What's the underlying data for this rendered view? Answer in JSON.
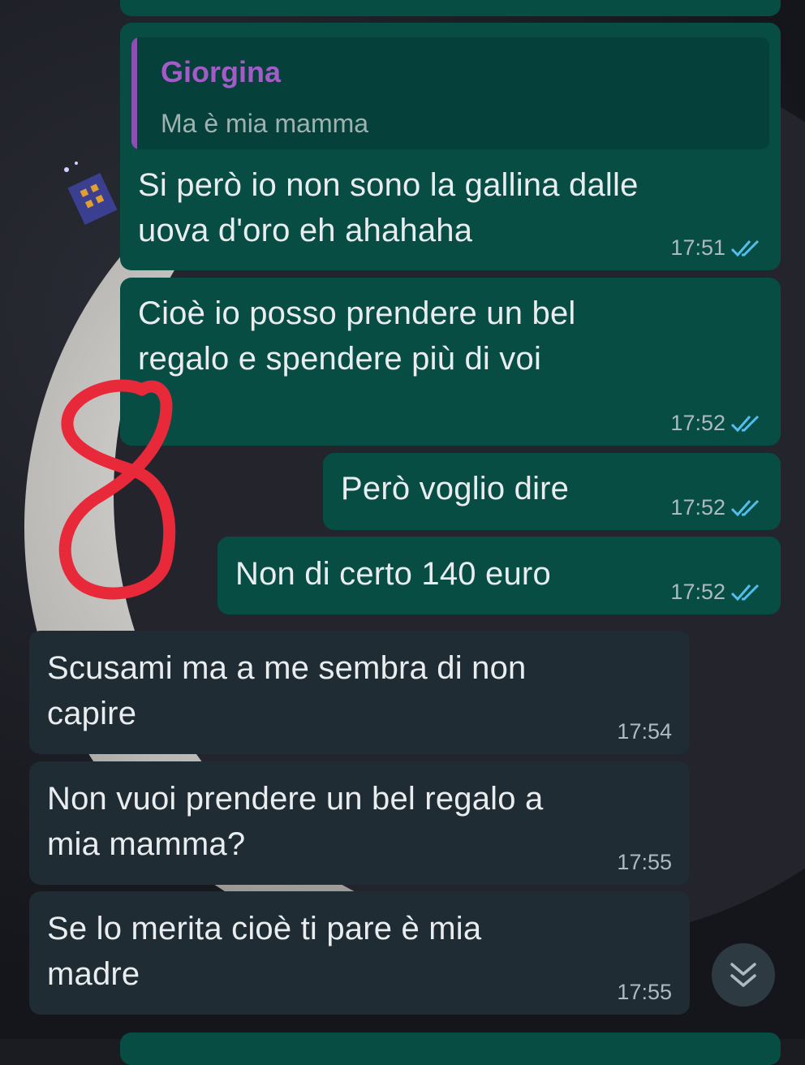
{
  "messages": [
    {
      "direction": "outgoing",
      "reply_to": {
        "author": "Giorgina",
        "text": "Ma è mia mamma"
      },
      "text_lines": [
        "Si però io non sono la gallina dalle",
        "uova d'oro eh ahahaha"
      ],
      "time": "17:51",
      "status": "read"
    },
    {
      "direction": "outgoing",
      "text_lines": [
        "Cioè io posso prendere un bel",
        "regalo e spendere più di voi"
      ],
      "time": "17:52",
      "status": "read"
    },
    {
      "direction": "outgoing",
      "text_lines": [
        "Però voglio dire"
      ],
      "time": "17:52",
      "status": "read"
    },
    {
      "direction": "outgoing",
      "text_lines": [
        "Non di certo 140 euro"
      ],
      "time": "17:52",
      "status": "read"
    },
    {
      "direction": "incoming",
      "text_lines": [
        "Scusami ma a me sembra di non",
        "capire"
      ],
      "time": "17:54"
    },
    {
      "direction": "incoming",
      "text_lines": [
        "Non vuoi prendere un bel regalo a",
        "mia mamma?"
      ],
      "time": "17:55"
    },
    {
      "direction": "incoming",
      "text_lines": [
        "Se lo merita cioè ti pare è mia",
        "madre"
      ],
      "time": "17:55"
    }
  ],
  "annotation": {
    "label": "8",
    "color": "#e8293a"
  },
  "icons": {
    "read_ticks": "double-check-icon",
    "scroll_down": "chevron-down-icon"
  },
  "colors": {
    "outgoing_bubble": "#074d44",
    "incoming_bubble": "#202c33",
    "read_tick": "#53bdeb",
    "reply_author": "#a35bc8"
  }
}
